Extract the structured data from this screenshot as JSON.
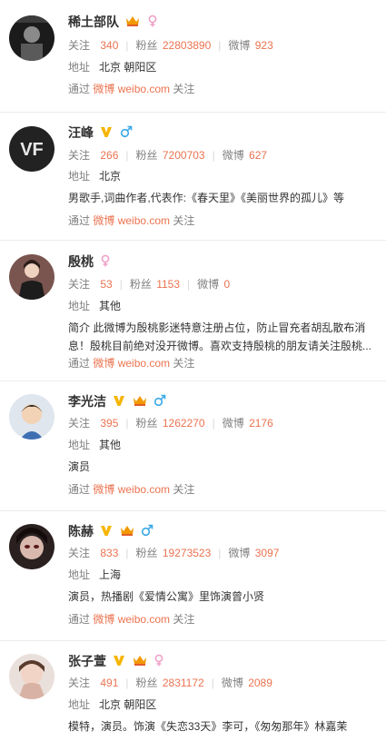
{
  "labels": {
    "follow": "关注",
    "fans": "粉丝",
    "weibo": "微博",
    "address": "地址",
    "intro": "简介",
    "via": "通过",
    "via_link": "微博 weibo.com",
    "via_suffix": "关注"
  },
  "colors": {
    "accent": "#eb7350",
    "verified_gold": "#f6b500",
    "male_blue": "#3aa8e8",
    "female_pink": "#f0a2c9"
  },
  "users": [
    {
      "name": "稀土部队",
      "badges": [
        "vip-crown-icon",
        "female-icon"
      ],
      "follow": "340",
      "fans": "22803890",
      "weibo": "923",
      "address": "北京 朝阳区",
      "desc": ""
    },
    {
      "name": "汪峰",
      "badges": [
        "verified-v-icon",
        "male-icon"
      ],
      "follow": "266",
      "fans": "7200703",
      "weibo": "627",
      "address": "北京",
      "desc": "男歌手,词曲作者,代表作:《春天里》《美丽世界的孤儿》等"
    },
    {
      "name": "殷桃",
      "badges": [
        "female-icon"
      ],
      "follow": "53",
      "fans": "1153",
      "weibo": "0",
      "address": "其他",
      "desc": "简介 此微博为殷桃影迷特意注册占位，防止冒充者胡乱散布消息！殷桃目前绝对没开微博。喜欢支持殷桃的朋友请关注殷桃..."
    },
    {
      "name": "李光洁",
      "badges": [
        "verified-v-icon",
        "vip-crown-icon",
        "male-icon"
      ],
      "follow": "395",
      "fans": "1262270",
      "weibo": "2176",
      "address": "其他",
      "desc": "演员"
    },
    {
      "name": "陈赫",
      "badges": [
        "verified-v-icon",
        "vip-crown-icon",
        "male-icon"
      ],
      "follow": "833",
      "fans": "19273523",
      "weibo": "3097",
      "address": "上海",
      "desc": "演员，热播剧《爱情公寓》里饰演曾小贤"
    },
    {
      "name": "张子萱",
      "badges": [
        "verified-v-icon",
        "vip-crown-icon",
        "female-icon"
      ],
      "follow": "491",
      "fans": "2831172",
      "weibo": "2089",
      "address": "北京 朝阳区",
      "desc": "模特，演员。饰演《失恋33天》李可，《匆匆那年》林嘉茉"
    }
  ]
}
